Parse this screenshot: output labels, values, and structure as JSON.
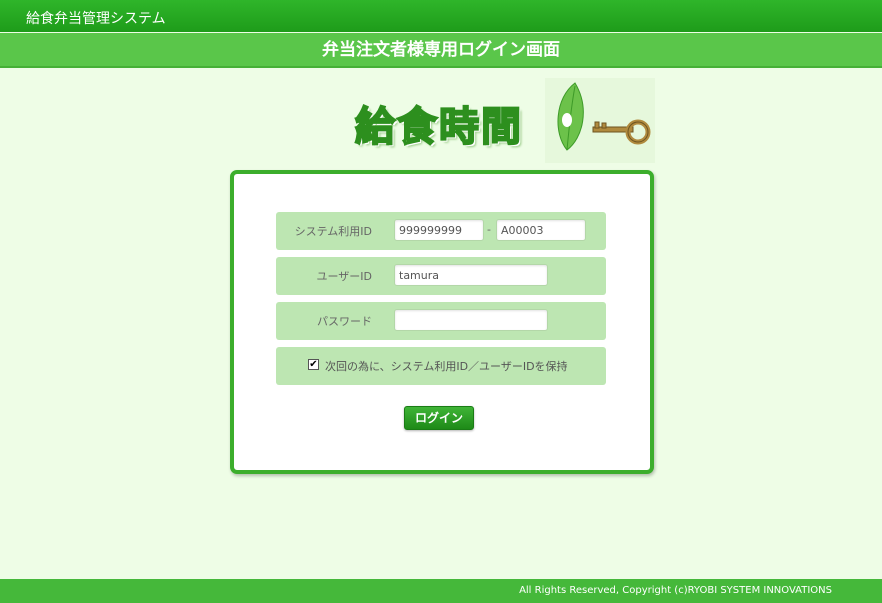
{
  "app": {
    "title": "給食弁当管理システム"
  },
  "page": {
    "title": "弁当注文者様専用ログイン画面"
  },
  "logo": {
    "text": "給食時間",
    "icons": [
      "leaf-icon",
      "key-icon"
    ]
  },
  "form": {
    "system_id": {
      "label": "システム利用ID",
      "value1": "999999999",
      "separator": "-",
      "value2": "A00003"
    },
    "user_id": {
      "label": "ユーザーID",
      "value": "tamura"
    },
    "password": {
      "label": "パスワード",
      "value": ""
    },
    "remember": {
      "checked": true,
      "check_glyph": "✔",
      "label": "次回の為に、システム利用ID／ユーザーIDを保持"
    },
    "login_button": "ログイン"
  },
  "footer": {
    "copyright": "All Rights Reserved, Copyright (c)RYOBI SYSTEM INNOVATIONS"
  },
  "colors": {
    "header": "#1e9c1a",
    "subheader": "#5ac64a",
    "background": "#eefde6",
    "panel_border": "#3cae2c",
    "row": "#bde6b2"
  }
}
